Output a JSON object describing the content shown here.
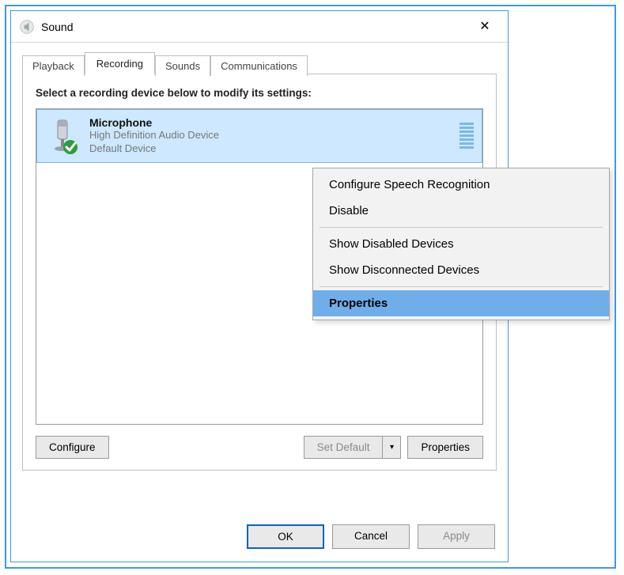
{
  "window": {
    "title": "Sound"
  },
  "tabs": [
    {
      "label": "Playback"
    },
    {
      "label": "Recording"
    },
    {
      "label": "Sounds"
    },
    {
      "label": "Communications"
    }
  ],
  "active_tab_index": 1,
  "instruction": "Select a recording device below to modify its settings:",
  "devices": [
    {
      "name": "Microphone",
      "description": "High Definition Audio Device",
      "status": "Default Device",
      "selected": true
    }
  ],
  "panel_buttons": {
    "configure": "Configure",
    "set_default": "Set Default",
    "properties": "Properties"
  },
  "footer": {
    "ok": "OK",
    "cancel": "Cancel",
    "apply": "Apply"
  },
  "context_menu": {
    "items": [
      {
        "label": "Configure Speech Recognition"
      },
      {
        "label": "Disable"
      }
    ],
    "items2": [
      {
        "label": "Show Disabled Devices"
      },
      {
        "label": "Show Disconnected Devices"
      }
    ],
    "highlight": {
      "label": "Properties"
    }
  }
}
